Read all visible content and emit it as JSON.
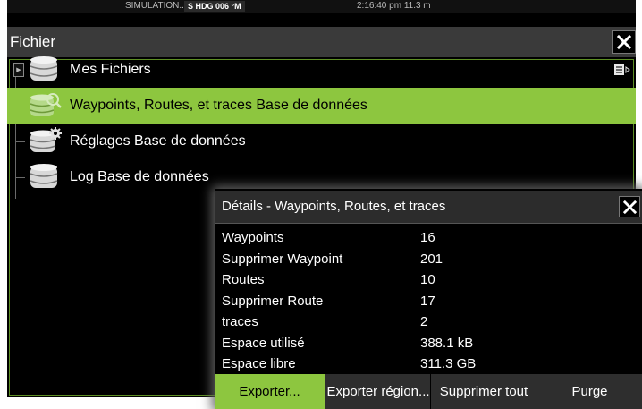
{
  "status": {
    "simulation": "SIMULATION...",
    "hdg": "S HDG 006 °M",
    "time_depth": "2:16:40 pm  11.3 m"
  },
  "window": {
    "title": "Fichier",
    "close_icon": "close-icon"
  },
  "files": [
    {
      "label": "Mes Fichiers",
      "icon": "database-icon",
      "selected": false
    },
    {
      "label": "Waypoints, Routes, et traces Base de données",
      "icon": "database-search-icon",
      "selected": true
    },
    {
      "label": "Réglages Base de données",
      "icon": "database-gear-icon",
      "selected": false
    },
    {
      "label": "Log Base de données",
      "icon": "database-icon",
      "selected": false
    }
  ],
  "dialog": {
    "title": "Détails - Waypoints, Routes, et traces",
    "rows": [
      {
        "label": "Waypoints",
        "value": "16"
      },
      {
        "label": "Supprimer Waypoint",
        "value": "201"
      },
      {
        "label": "Routes",
        "value": "10"
      },
      {
        "label": "Supprimer Route",
        "value": "17"
      },
      {
        "label": "traces",
        "value": "2"
      },
      {
        "label": "Espace utilisé",
        "value": "388.1 kB"
      },
      {
        "label": "Espace libre",
        "value": "311.3 GB"
      }
    ],
    "buttons": {
      "export": "Exporter...",
      "export_region": "Exporter région...",
      "delete_all": "Supprimer tout",
      "purge": "Purge"
    }
  },
  "colors": {
    "accent": "#8dc63f",
    "background": "#000000",
    "titlebar": "#3a3a3a"
  }
}
